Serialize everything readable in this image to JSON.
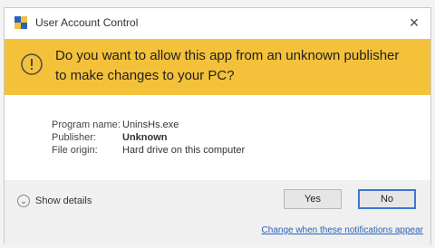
{
  "window": {
    "title": "User Account Control",
    "close_glyph": "×"
  },
  "banner": {
    "icon": "warning-icon",
    "message": "Do you want to allow this app from an unknown publisher to make changes to your PC?",
    "color": "#f4c13a"
  },
  "info": {
    "rows": [
      {
        "label": "Program name:",
        "value": "UninsHs.exe"
      },
      {
        "label": "Publisher:",
        "value": "Unknown"
      },
      {
        "label": "File origin:",
        "value": "Hard drive on this computer"
      }
    ]
  },
  "footer": {
    "show_details_label": "Show details",
    "yes_label": "Yes",
    "no_label": "No",
    "settings_link": "Change when these notifications appear",
    "accent_color": "#3b78d1"
  }
}
